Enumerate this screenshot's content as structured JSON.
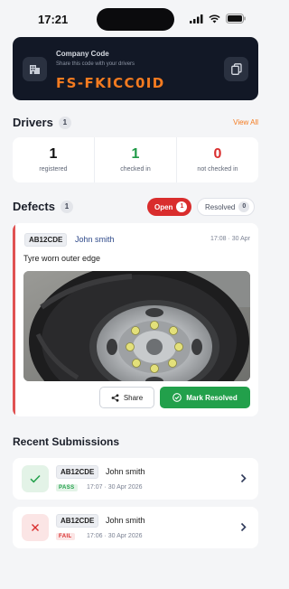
{
  "status_bar": {
    "time": "17:21"
  },
  "company": {
    "title": "Company Code",
    "subtitle": "Share this code with your drivers",
    "code": "FS-FKICC0ID"
  },
  "drivers": {
    "title": "Drivers",
    "count": "1",
    "view_all": "View All",
    "stats": [
      {
        "value": "1",
        "label": "registered",
        "color": "#111111"
      },
      {
        "value": "1",
        "label": "checked in",
        "color": "#1f9a47"
      },
      {
        "value": "0",
        "label": "not checked in",
        "color": "#d92d2d"
      }
    ]
  },
  "defects": {
    "title": "Defects",
    "count": "1",
    "filters": {
      "open_label": "Open",
      "open_count": "1",
      "resolved_label": "Resolved",
      "resolved_count": "0"
    },
    "item": {
      "plate": "AB12CDE",
      "driver": "John smith",
      "time": "17:08 · 30 Apr",
      "description": "Tyre worn outer edge",
      "share_label": "Share",
      "resolve_label": "Mark Resolved"
    }
  },
  "recent": {
    "title": "Recent Submissions",
    "items": [
      {
        "plate": "AB12CDE",
        "driver": "John smith",
        "status": "PASS",
        "time": "17:07 · 30 Apr 2026",
        "icon": "check-icon"
      },
      {
        "plate": "AB12CDE",
        "driver": "John smith",
        "status": "FAIL",
        "time": "17:06 · 30 Apr 2026",
        "icon": "cross-icon"
      }
    ]
  },
  "colors": {
    "accent": "#f47b20",
    "pass": "#22a04b",
    "fail": "#d92d2d",
    "dark_card": "#121826"
  }
}
